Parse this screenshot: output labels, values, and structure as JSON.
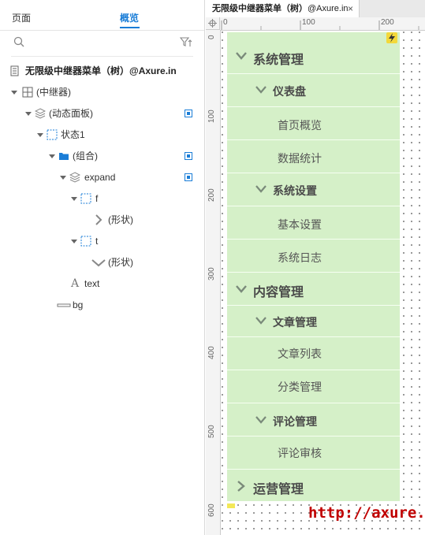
{
  "left_panel": {
    "tabs": {
      "pages": "页面",
      "outline": "概览"
    },
    "tree_title": "无限级中继器菜单（树）@Axure.in",
    "tree": [
      {
        "label": "(中继器)",
        "icon": "repeater-icon"
      },
      {
        "label": "(动态面板)",
        "icon": "dynamic-panel-icon"
      },
      {
        "label": "状态1",
        "icon": "state-icon"
      },
      {
        "label": "(组合)",
        "icon": "folder-icon"
      },
      {
        "label": "expand",
        "icon": "dynamic-panel-icon"
      },
      {
        "label": "f",
        "icon": "state-icon"
      },
      {
        "label": "(形状)",
        "icon": "chevron-right-icon"
      },
      {
        "label": "t",
        "icon": "state-icon"
      },
      {
        "label": "(形状)",
        "icon": "chevron-down-icon"
      },
      {
        "label": "text",
        "icon": "text-icon"
      },
      {
        "label": "bg",
        "icon": "rectangle-icon"
      }
    ]
  },
  "canvas": {
    "doc_tab": {
      "bold": "无限级中继器菜单（树）",
      "sub": "@Axure.in",
      "close": "×"
    },
    "hruler": [
      "0",
      "100",
      "200"
    ],
    "vruler": [
      "0",
      "100",
      "200",
      "300",
      "400",
      "500",
      "600"
    ],
    "menu": [
      {
        "label": "系统管理",
        "level": 1,
        "arrow": "down"
      },
      {
        "label": "仪表盘",
        "level": 2,
        "arrow": "down"
      },
      {
        "label": "首页概览",
        "level": 3
      },
      {
        "label": "数据统计",
        "level": 3
      },
      {
        "label": "系统设置",
        "level": 2,
        "arrow": "down"
      },
      {
        "label": "基本设置",
        "level": 3
      },
      {
        "label": "系统日志",
        "level": 3
      },
      {
        "label": "内容管理",
        "level": 1,
        "arrow": "down"
      },
      {
        "label": "文章管理",
        "level": 2,
        "arrow": "down"
      },
      {
        "label": "文章列表",
        "level": 3
      },
      {
        "label": "分类管理",
        "level": 3
      },
      {
        "label": "评论管理",
        "level": 2,
        "arrow": "down"
      },
      {
        "label": "评论审核",
        "level": 3
      },
      {
        "label": "运营管理",
        "level": 1,
        "arrow": "right"
      }
    ],
    "watermark": "http://axure.in",
    "colors": {
      "menu_bg": "#d5f0c8",
      "accent": "#1a7dd7",
      "watermark": "#c00000"
    }
  }
}
